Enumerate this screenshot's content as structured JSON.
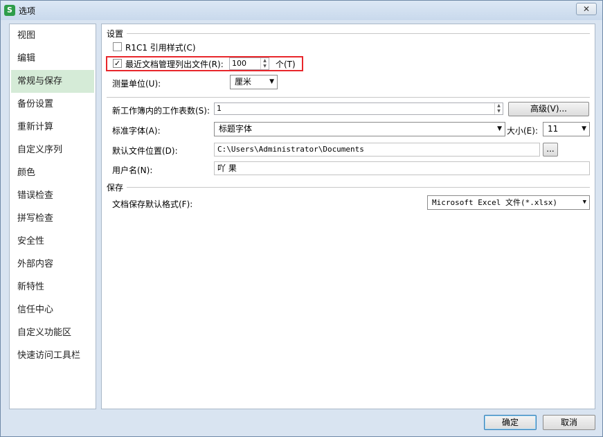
{
  "window": {
    "title": "选项",
    "app_icon_letter": "S",
    "close_glyph": "✕"
  },
  "sidebar": {
    "items": [
      {
        "label": "视图"
      },
      {
        "label": "编辑"
      },
      {
        "label": "常规与保存",
        "active": true
      },
      {
        "label": "备份设置"
      },
      {
        "label": "重新计算"
      },
      {
        "label": "自定义序列"
      },
      {
        "label": "颜色"
      },
      {
        "label": "错误检查"
      },
      {
        "label": "拼写检查"
      },
      {
        "label": "安全性"
      },
      {
        "label": "外部内容"
      },
      {
        "label": "新特性"
      },
      {
        "label": "信任中心"
      },
      {
        "label": "自定义功能区"
      },
      {
        "label": "快速访问工具栏"
      }
    ]
  },
  "settings": {
    "section_title": "设置",
    "r1c1_label": "R1C1 引用样式(C)",
    "r1c1_checked": false,
    "recent_label": "最近文档管理列出文件(R):",
    "recent_checked": true,
    "recent_value": "100",
    "recent_unit": "个(T)",
    "measure_label": "测量单位(U):",
    "measure_value": "厘米",
    "sheets_label": "新工作簿内的工作表数(S):",
    "sheets_value": "1",
    "advanced_button": "高级(V)...",
    "font_label": "标准字体(A):",
    "font_value": "标题字体",
    "size_label": "大小(E):",
    "size_value": "11",
    "location_label": "默认文件位置(D):",
    "location_value": "C:\\Users\\Administrator\\Documents",
    "browse_button": "...",
    "username_label": "用户名(N):",
    "username_value": "吖 果"
  },
  "save": {
    "section_title": "保存",
    "format_label": "文档保存默认格式(F):",
    "format_value": "Microsoft Excel 文件(*.xlsx)"
  },
  "footer": {
    "ok_label": "确定",
    "cancel_label": "取消"
  },
  "colors": {
    "highlight": "#e8262b",
    "active_item": "#d5ebd7",
    "window_bg": "#d9e4f1"
  },
  "icons": {
    "dropdown": "▼",
    "spin_up": "▲",
    "spin_down": "▼",
    "check": "✓"
  }
}
